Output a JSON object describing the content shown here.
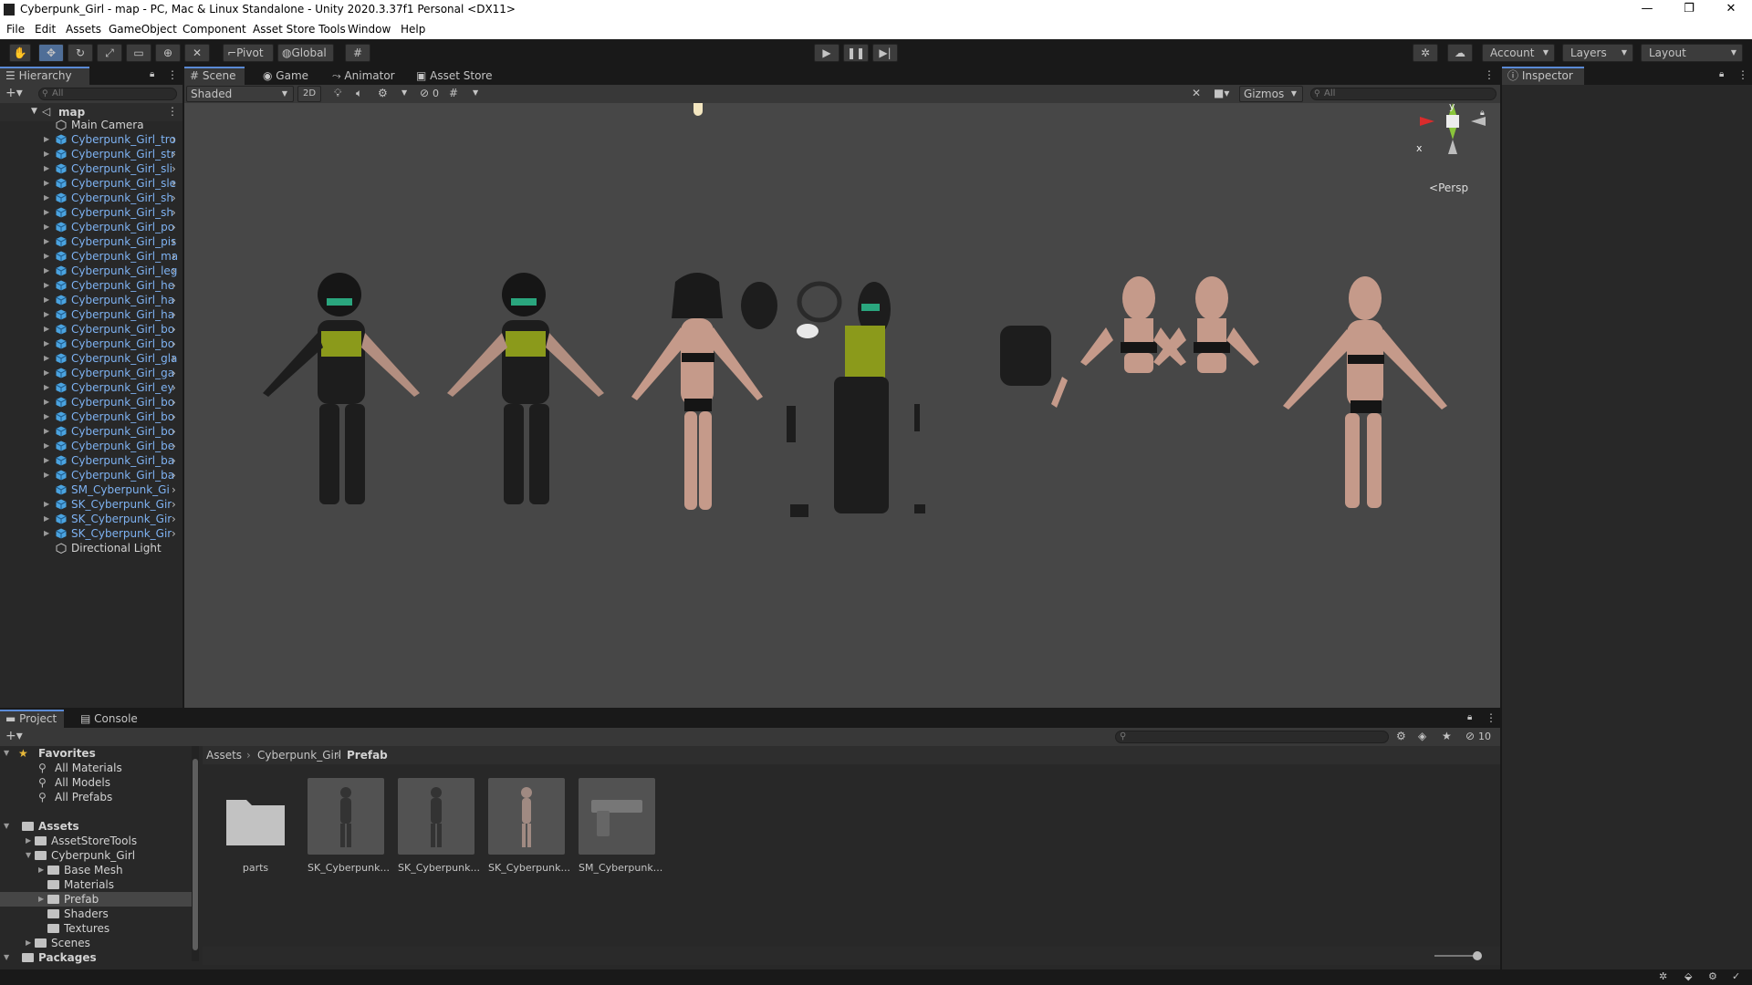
{
  "window": {
    "title": "Cyberpunk_Girl - map - PC, Mac & Linux Standalone - Unity 2020.3.37f1 Personal <DX11>",
    "controls": [
      "—",
      "❐",
      "✕"
    ]
  },
  "menu": [
    "File",
    "Edit",
    "Assets",
    "GameObject",
    "Component",
    "Asset Store Tools",
    "Window",
    "Help"
  ],
  "toolbar": {
    "pivot": "Pivot",
    "global": "Global",
    "account": "Account",
    "layers": "Layers",
    "layout": "Layout"
  },
  "hierarchy": {
    "tab": "Hierarchy",
    "search_placeholder": "All",
    "scene": "map",
    "items": [
      {
        "label": "Main Camera",
        "type": "plain"
      },
      {
        "label": "Cyberpunk_Girl_tro",
        "type": "prefab"
      },
      {
        "label": "Cyberpunk_Girl_str",
        "type": "prefab"
      },
      {
        "label": "Cyberpunk_Girl_sli",
        "type": "prefab"
      },
      {
        "label": "Cyberpunk_Girl_sle",
        "type": "prefab"
      },
      {
        "label": "Cyberpunk_Girl_sh",
        "type": "prefab"
      },
      {
        "label": "Cyberpunk_Girl_sh",
        "type": "prefab"
      },
      {
        "label": "Cyberpunk_Girl_po",
        "type": "prefab"
      },
      {
        "label": "Cyberpunk_Girl_pis",
        "type": "prefab"
      },
      {
        "label": "Cyberpunk_Girl_ma",
        "type": "prefab"
      },
      {
        "label": "Cyberpunk_Girl_leg",
        "type": "prefab"
      },
      {
        "label": "Cyberpunk_Girl_he",
        "type": "prefab"
      },
      {
        "label": "Cyberpunk_Girl_ha",
        "type": "prefab"
      },
      {
        "label": "Cyberpunk_Girl_ha",
        "type": "prefab"
      },
      {
        "label": "Cyberpunk_Girl_bo",
        "type": "prefab"
      },
      {
        "label": "Cyberpunk_Girl_bo",
        "type": "prefab"
      },
      {
        "label": "Cyberpunk_Girl_gla",
        "type": "prefab"
      },
      {
        "label": "Cyberpunk_Girl_ga",
        "type": "prefab"
      },
      {
        "label": "Cyberpunk_Girl_ey",
        "type": "prefab"
      },
      {
        "label": "Cyberpunk_Girl_bo",
        "type": "prefab"
      },
      {
        "label": "Cyberpunk_Girl_bo",
        "type": "prefab"
      },
      {
        "label": "Cyberpunk_Girl_bo",
        "type": "prefab"
      },
      {
        "label": "Cyberpunk_Girl_be",
        "type": "prefab"
      },
      {
        "label": "Cyberpunk_Girl_ba",
        "type": "prefab"
      },
      {
        "label": "Cyberpunk_Girl_ba",
        "type": "prefab"
      },
      {
        "label": "SM_Cyberpunk_Gi",
        "type": "prefab-nofold"
      },
      {
        "label": "SK_Cyberpunk_Gir",
        "type": "prefab"
      },
      {
        "label": "SK_Cyberpunk_Gir",
        "type": "prefab"
      },
      {
        "label": "SK_Cyberpunk_Gir",
        "type": "prefab"
      },
      {
        "label": "Directional Light",
        "type": "plain"
      }
    ]
  },
  "scene_view": {
    "tabs": [
      "Scene",
      "Game",
      "Animator",
      "Asset Store"
    ],
    "shading": "Shaded",
    "mode_2d": "2D",
    "hidden_count": "0",
    "gizmos": "Gizmos",
    "search_placeholder": "All",
    "projection": "Persp",
    "axis_x": "x",
    "axis_y": "y"
  },
  "inspector": {
    "tab": "Inspector"
  },
  "project": {
    "tabs": [
      "Project",
      "Console"
    ],
    "hidden_count": "10",
    "breadcrumb": [
      "Assets",
      "Cyberpunk_Girl",
      "Prefab"
    ],
    "tree": [
      {
        "label": "Favorites",
        "bold": true,
        "indent": 0,
        "icon": "star"
      },
      {
        "label": "All Materials",
        "indent": 1,
        "icon": "search"
      },
      {
        "label": "All Models",
        "indent": 1,
        "icon": "search"
      },
      {
        "label": "All Prefabs",
        "indent": 1,
        "icon": "search"
      },
      {
        "label": "",
        "indent": 0,
        "icon": "none"
      },
      {
        "label": "Assets",
        "bold": true,
        "indent": 0,
        "icon": "folder"
      },
      {
        "label": "AssetStoreTools",
        "indent": 1,
        "icon": "folder"
      },
      {
        "label": "Cyberpunk_Girl",
        "indent": 1,
        "icon": "folder-open"
      },
      {
        "label": "Base Mesh",
        "indent": 2,
        "icon": "folder"
      },
      {
        "label": "Materials",
        "indent": 2,
        "icon": "folder"
      },
      {
        "label": "Prefab",
        "indent": 2,
        "icon": "folder",
        "selected": true
      },
      {
        "label": "Shaders",
        "indent": 2,
        "icon": "folder"
      },
      {
        "label": "Textures",
        "indent": 2,
        "icon": "folder"
      },
      {
        "label": "Scenes",
        "indent": 1,
        "icon": "folder"
      },
      {
        "label": "Packages",
        "bold": true,
        "indent": 0,
        "icon": "folder"
      }
    ],
    "assets": [
      {
        "label": "parts",
        "kind": "folder"
      },
      {
        "label": "SK_Cyberpunk...",
        "kind": "model"
      },
      {
        "label": "SK_Cyberpunk...",
        "kind": "model"
      },
      {
        "label": "SK_Cyberpunk...",
        "kind": "model"
      },
      {
        "label": "SM_Cyberpunk...",
        "kind": "gun"
      }
    ]
  }
}
